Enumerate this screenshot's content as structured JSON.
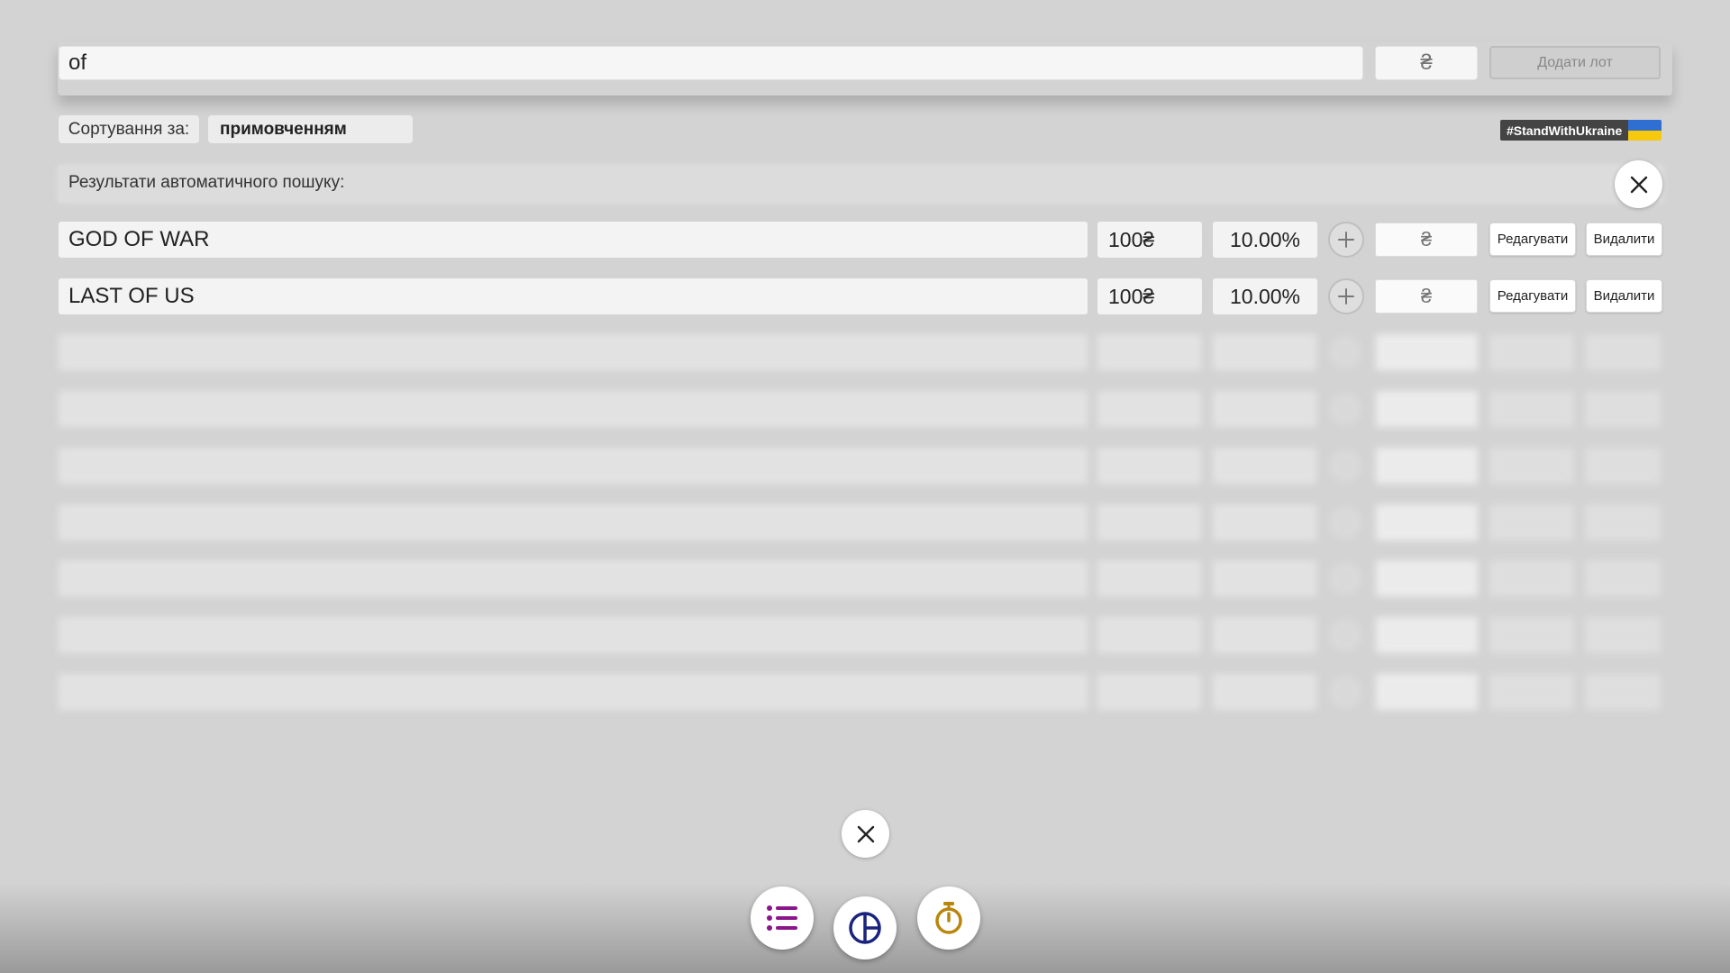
{
  "top_bar": {
    "search_value": "of",
    "price_placeholder": "₴",
    "add_button_label": "Додати лот"
  },
  "sort": {
    "label": "Сортування за:",
    "selected": "примовченням"
  },
  "badge": {
    "text": "#StandWithUkraine",
    "flag_colors": [
      "#2f6fd1",
      "#f6c90e"
    ]
  },
  "results": {
    "label": "Результати автоматичного пошуку:",
    "rows": [
      {
        "name": "GOD OF WAR",
        "price": "100₴",
        "percent": "10.00%",
        "input_placeholder": "₴",
        "edit_label": "Редагувати",
        "delete_label": "Видалити"
      },
      {
        "name": "LAST OF US",
        "price": "100₴",
        "percent": "10.00%",
        "input_placeholder": "₴",
        "edit_label": "Редагувати",
        "delete_label": "Видалити"
      }
    ]
  },
  "bottom_nav": {
    "icons": [
      "list-icon",
      "pie-chart-icon",
      "stopwatch-icon"
    ],
    "icon_colors": [
      "#8b168b",
      "#1a237e",
      "#b8860b"
    ]
  }
}
